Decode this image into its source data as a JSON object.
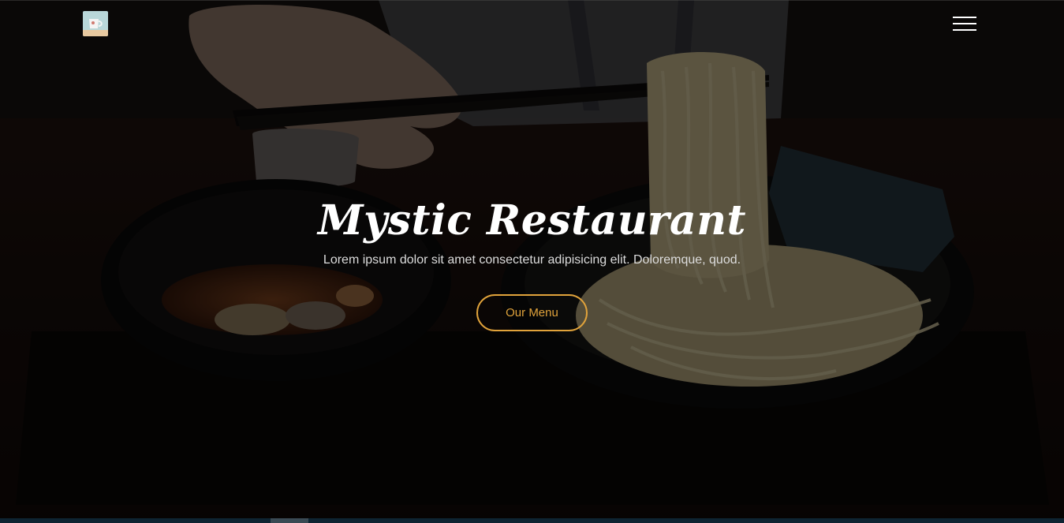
{
  "header": {
    "logo_icon": "cup-logo-icon",
    "menu_icon": "hamburger-menu-icon"
  },
  "hero": {
    "title": "Mystic Restaurant",
    "subtitle": "Lorem ipsum dolor sit amet consectetur adipisicing elit. Doloremque, quod.",
    "button_label": "Our Menu"
  },
  "colors": {
    "accent": "#e1a33b",
    "text": "#ffffff",
    "overlay": "#000000"
  }
}
